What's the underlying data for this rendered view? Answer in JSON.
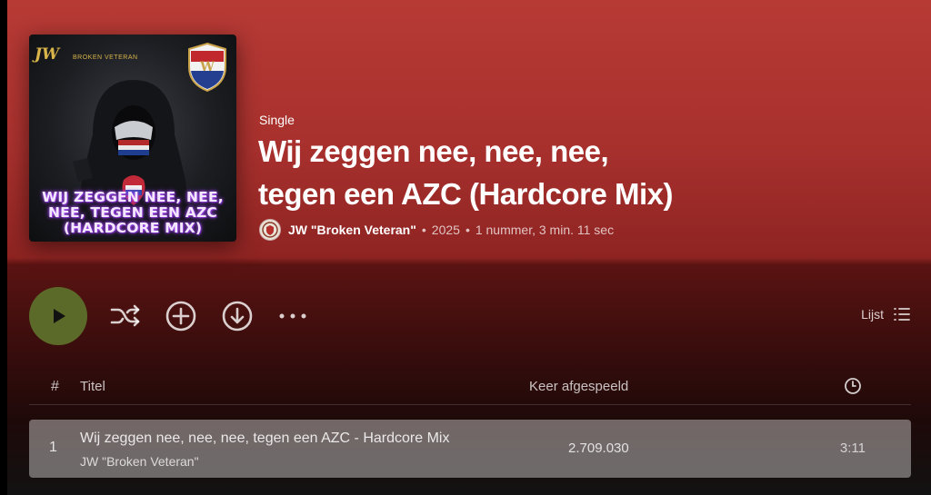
{
  "album": {
    "type_label": "Single",
    "title_line1": "Wij zeggen nee, nee, nee,",
    "title_line2": "tegen een AZC (Hardcore Mix)",
    "artist": "JW \"Broken Veteran\"",
    "year": "2025",
    "summary": "1 nummer, 3 min. 11 sec"
  },
  "cover": {
    "logo_text": "JW",
    "logo_subtitle": "BROKEN VETERAN",
    "title_line1": "WIJ ZEGGEN NEE, NEE,",
    "title_line2": "NEE, TEGEN EEN AZC",
    "title_line3": "(HARDCORE MIX)"
  },
  "actions": {
    "list_label": "Lijst",
    "icons": [
      "play-icon",
      "shuffle-icon",
      "add-icon",
      "download-icon",
      "more-icon",
      "list-icon"
    ]
  },
  "table": {
    "headers": {
      "num": "#",
      "title": "Titel",
      "plays": "Keer afgespeeld",
      "duration_icon": "clock-icon"
    },
    "rows": [
      {
        "num": "1",
        "title": "Wij zeggen nee, nee, nee, tegen een AZC - Hardcore Mix",
        "artist": "JW \"Broken Veteran\"",
        "plays": "2.709.030",
        "duration": "3:11"
      }
    ]
  },
  "colors": {
    "header_red": "#b73a35",
    "play_button": "#5c6a29",
    "row_highlight": "#6b6b6b"
  }
}
